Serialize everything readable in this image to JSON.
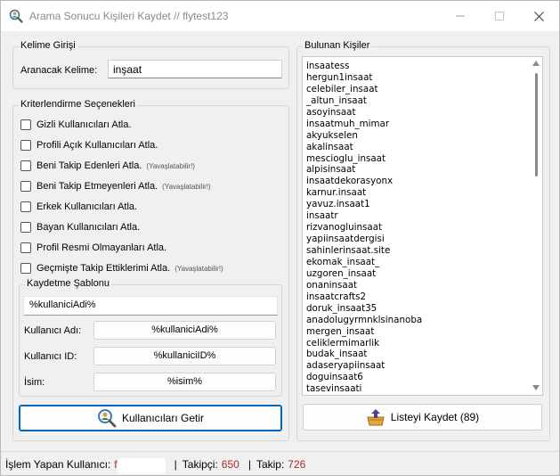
{
  "window": {
    "title": "Arama Sonucu Kişileri Kaydet // flytest123"
  },
  "search_group": {
    "title": "Kelime Girişi",
    "label": "Aranacak Kelime:",
    "value": "inşaat"
  },
  "criteria_group": {
    "title": "Kriterlendirme Seçenekleri",
    "options": [
      {
        "label": "Gizli Kullanıcıları Atla.",
        "hint": "",
        "checked": false
      },
      {
        "label": "Profili Açık Kullanıcıları Atla.",
        "hint": "",
        "checked": false
      },
      {
        "label": "Beni Takip Edenleri Atla.",
        "hint": "(Yavaşlatabilir!)",
        "checked": false
      },
      {
        "label": "Beni Takip Etmeyenleri Atla.",
        "hint": "(Yavaşlatabilir!)",
        "checked": false
      },
      {
        "label": "Erkek Kullanıcıları Atla.",
        "hint": "",
        "checked": false
      },
      {
        "label": "Bayan Kullanıcıları Atla.",
        "hint": "",
        "checked": false
      },
      {
        "label": "Profil Resmi Olmayanları Atla.",
        "hint": "",
        "checked": false
      },
      {
        "label": "Geçmişte Takip Ettiklerimi Atla.",
        "hint": "(Yavaşlatabilir!)",
        "checked": false
      }
    ]
  },
  "template_group": {
    "title": "Kaydetme Şablonu",
    "template_value": "%kullaniciAdi%",
    "fields": [
      {
        "label": "Kullanıcı Adı:",
        "value": "%kullaniciAdi%"
      },
      {
        "label": "Kullanıcı ID:",
        "value": "%kullaniciID%"
      },
      {
        "label": "İsim:",
        "value": "%isim%"
      }
    ]
  },
  "buttons": {
    "fetch_label": "Kullanıcıları Getir",
    "save_label": "Listeyi Kaydet (89)"
  },
  "found_group": {
    "title": "Bulunan Kişiler",
    "items": [
      "insaatess",
      "hergun1insaat",
      "celebiler_insaat",
      "_altun_insaat",
      "asoyinsaat",
      "insaatmuh_mimar",
      "akyukselen",
      "akalinsaat",
      "mescioglu_insaat",
      "alpisinsaat",
      "insaatdekorasyonx",
      "karnur.insaat",
      "yavuz.insaat1",
      "insaatr",
      "rizvanogluinsaat",
      "yapiinsaatdergisi",
      "sahinlerinsaat.site",
      "ekomak_insaat_",
      "uzgoren_insaat",
      "onaninsaat",
      "insaatcrafts2",
      "doruk_insaat35",
      "anadolugyrmnklsinanoba",
      "mergen_insaat",
      "celiklermimarlik",
      "budak_insaat",
      "adaseryapiinsaat",
      "doguinsaat6",
      "tasevinsaati"
    ]
  },
  "status": {
    "user_label": "İşlem Yapan Kullanıcı:",
    "user_value": "f",
    "followers_label": "Takipçi:",
    "followers_value": "650",
    "following_label": "Takip:",
    "following_value": "726"
  },
  "colors": {
    "accent": "#0067c0",
    "status_value": "#a52a2a"
  },
  "icons": {
    "app": "magnifier-user-icon",
    "fetch": "magnifier-user-icon",
    "save": "save-box-icon"
  }
}
